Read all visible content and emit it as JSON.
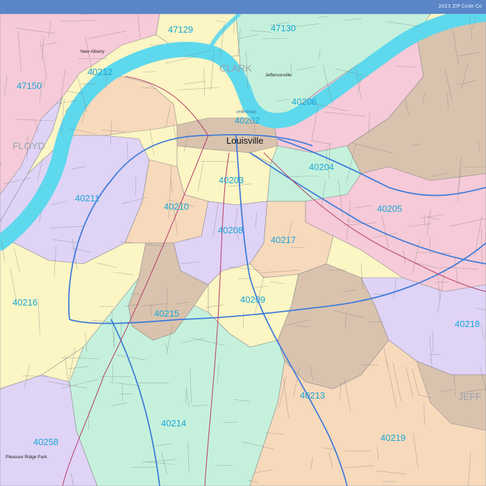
{
  "header": {
    "title": "2023 ZIP Code Co"
  },
  "colors": {
    "river": "#5ed8ec",
    "pink": "#f6cad8",
    "yellow": "#fcf5c4",
    "green": "#c5f1dc",
    "lavender": "#dfd3f6",
    "tan": "#d9c3ae",
    "peach": "#f7d9bc",
    "highway": "#3d7bd9",
    "road": "#b5456e"
  },
  "zips": [
    "47129",
    "47130",
    "40212",
    "47150",
    "40206",
    "40202",
    "40204",
    "40211",
    "40203",
    "40210",
    "40205",
    "40208",
    "40217",
    "40216",
    "40209",
    "40215",
    "40218",
    "40213",
    "40214",
    "40258",
    "40219"
  ],
  "counties": [
    "CLARK",
    "FLOYD",
    "JEFF"
  ],
  "city": "Louisville",
  "places": [
    "New Albany",
    "Jeffersonville",
    "Pleasure Ridge Park"
  ],
  "river_label": "OHIO RIVER"
}
